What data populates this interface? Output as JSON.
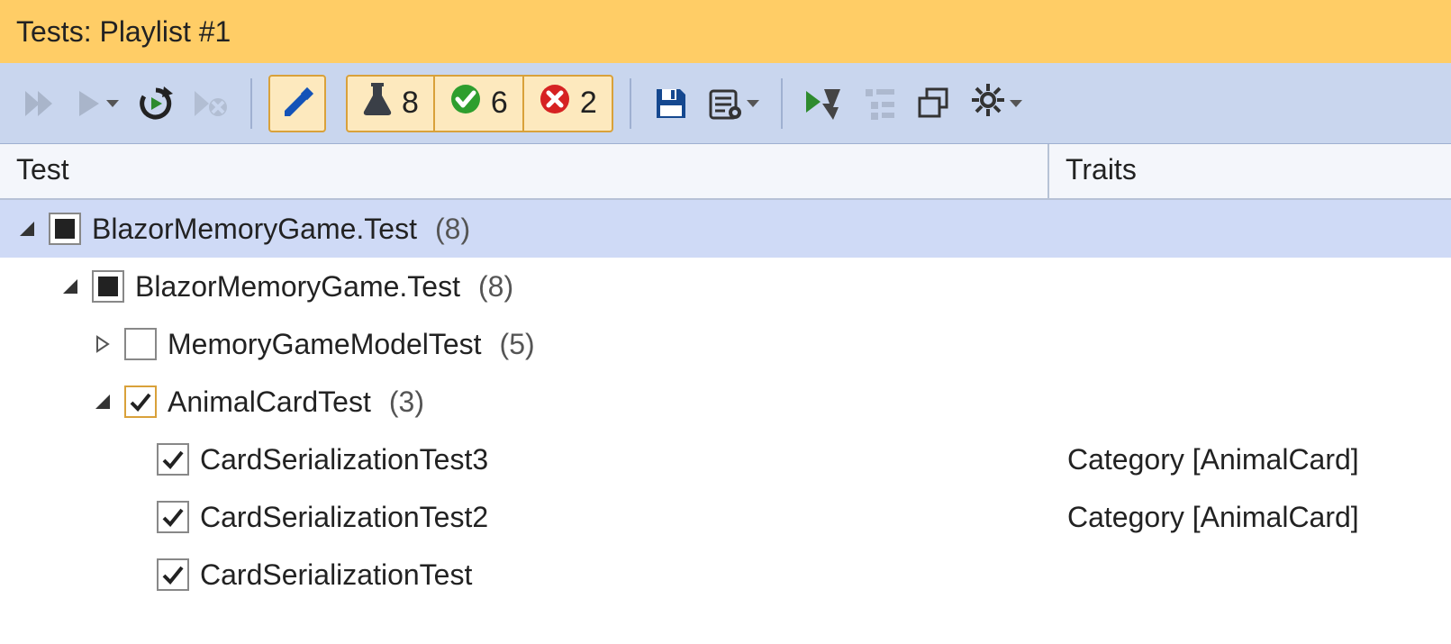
{
  "title": "Tests: Playlist #1",
  "toolbar": {
    "counts": {
      "total": "8",
      "passed": "6",
      "failed": "2"
    }
  },
  "columns": {
    "test": "Test",
    "traits": "Traits"
  },
  "tree": {
    "root": {
      "label": "BlazorMemoryGame.Test",
      "count": "(8)",
      "children": {
        "ns": {
          "label": "BlazorMemoryGame.Test",
          "count": "(8)",
          "children": {
            "memModel": {
              "label": "MemoryGameModelTest",
              "count": "(5)"
            },
            "animal": {
              "label": "AnimalCardTest",
              "count": "(3)",
              "children": {
                "t3": {
                  "label": "CardSerializationTest3",
                  "trait": "Category [AnimalCard]"
                },
                "t2": {
                  "label": "CardSerializationTest2",
                  "trait": "Category [AnimalCard]"
                },
                "t1": {
                  "label": "CardSerializationTest",
                  "trait": ""
                }
              }
            }
          }
        }
      }
    }
  }
}
